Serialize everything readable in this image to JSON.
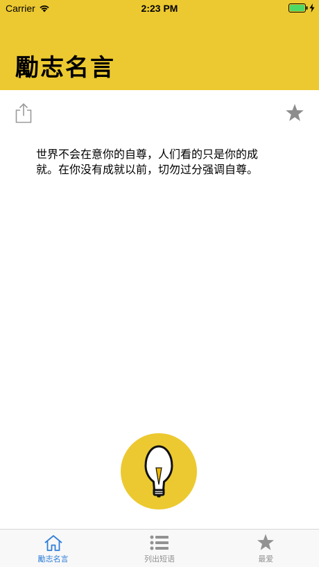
{
  "status_bar": {
    "carrier": "Carrier",
    "time": "2:23 PM"
  },
  "header": {
    "title": "勵志名言"
  },
  "actions": {
    "share_icon": "share-icon",
    "favorite_icon": "star-icon"
  },
  "quote": {
    "text": "世界不会在意你的自尊，人们看的只是你的成就。在你没有成就以前，切勿过分强调自尊。"
  },
  "bulb_button": {
    "icon": "lightbulb-icon"
  },
  "tab_bar": {
    "tabs": [
      {
        "label": "勵志名言",
        "icon": "home-icon",
        "active": true
      },
      {
        "label": "列出短语",
        "icon": "list-icon",
        "active": false
      },
      {
        "label": "最爱",
        "icon": "star-icon",
        "active": false
      }
    ]
  },
  "colors": {
    "header": "#ecc930",
    "active_tab": "#2f7ed8",
    "inactive_tab": "#929292",
    "battery": "#4cd964"
  }
}
